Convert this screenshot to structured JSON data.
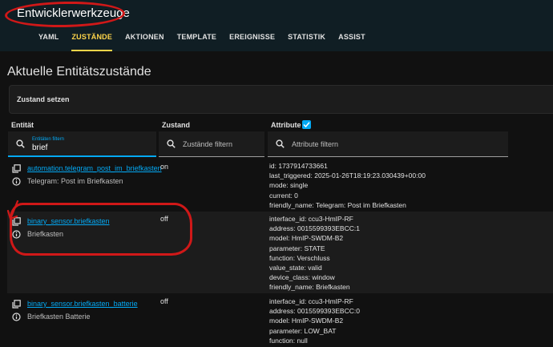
{
  "header": {
    "title": "Entwicklerwerkzeuge",
    "tabs": [
      "YAML",
      "ZUSTÄNDE",
      "AKTIONEN",
      "TEMPLATE",
      "EREIGNISSE",
      "STATISTIK",
      "ASSIST"
    ],
    "active_tab": "ZUSTÄNDE"
  },
  "main": {
    "title": "Aktuelle Entitätszustände",
    "set_state_label": "Zustand setzen",
    "columns": {
      "entity": "Entität",
      "state": "Zustand",
      "attributes": "Attribute"
    },
    "filters": {
      "entity_label": "Entitäten filtern",
      "entity_value": "brief",
      "state_placeholder": "Zustände filtern",
      "attribute_placeholder": "Attribute filtern"
    },
    "rows": [
      {
        "entity_id": "automation.telegram_post_im_briefkasten",
        "name": "Telegram: Post im Briefkasten",
        "state": "on",
        "attributes": [
          "id: 1737914733661",
          "last_triggered: 2025-01-26T18:19:23.030439+00:00",
          "mode: single",
          "current: 0",
          "friendly_name: Telegram: Post im Briefkasten"
        ]
      },
      {
        "entity_id": "binary_sensor.briefkasten",
        "name": "Briefkasten",
        "state": "off",
        "attributes": [
          "interface_id: ccu3-HmIP-RF",
          "address: 0015599393EBCC:1",
          "model: HmIP-SWDM-B2",
          "parameter: STATE",
          "function: Verschluss",
          "value_state: valid",
          "device_class: window",
          "friendly_name: Briefkasten"
        ]
      },
      {
        "entity_id": "binary_sensor.briefkasten_batterie",
        "name": "Briefkasten Batterie",
        "state": "off",
        "attributes": [
          "interface_id: ccu3-HmIP-RF",
          "address: 0015599393EBCC:0",
          "model: HmIP-SWDM-B2",
          "parameter: LOW_BAT",
          "function: null"
        ]
      }
    ]
  },
  "colors": {
    "accent": "#03a9f4",
    "active_tab": "#ffd54a",
    "annotation": "#d01818"
  }
}
